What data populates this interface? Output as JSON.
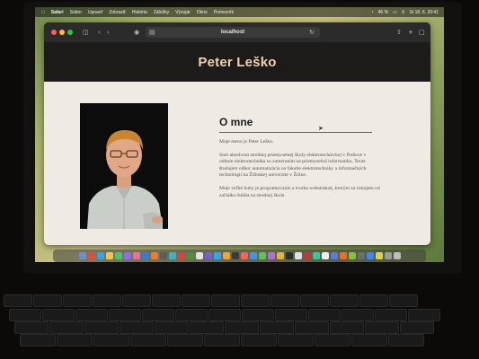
{
  "menubar": {
    "items": [
      "Safari",
      "Súbor",
      "Upraviť",
      "Zobraziť",
      "História",
      "Záložky",
      "Vývojár",
      "Okno",
      "Pomocník"
    ],
    "status": [
      "46 %",
      "St 18. 6.  20:41"
    ]
  },
  "browser": {
    "url": "localhost"
  },
  "site": {
    "title": "Peter Leško"
  },
  "about": {
    "heading": "O mne",
    "paragraphs": [
      "Moje meno je Peter Leško.",
      "Som absolvent strednej priemyselnej školy elektrotechnickej v Prešove v odbore elektrotechnika so zameraním na priemyselnú informatiku. Teraz študujem odbor automatizácia na fakulte elektrotechniky a informačných technológií na Žilinskej univerzite v Žiline.",
      "Moje veľké hoby je programovanie a tvorba webstránok, ktorým sa venujem od začiatku štúdia na strednej škole."
    ]
  },
  "dock": {
    "icon_colors": [
      "#6a8fd0",
      "#e44c3a",
      "#3aa0e8",
      "#f2c14e",
      "#4cc36b",
      "#8c6cf0",
      "#e86fa0",
      "#2f7fd8",
      "#f07b2b",
      "#5c5c5c",
      "#35b5c8",
      "#d94040",
      "#4d8f3f",
      "#e2e2e2",
      "#7b5cd6",
      "#2ea6ff",
      "#f4a13a",
      "#3b3b3b",
      "#ff5e5e",
      "#4a90e2",
      "#58c45a",
      "#b06fd8",
      "#e8b33a",
      "#2d2d2d",
      "#d6e4f0",
      "#c03a3a",
      "#3ac7a0",
      "#f0f0f0",
      "#5a7bd8",
      "#ee6b2b",
      "#87c13a",
      "#6d6d6d",
      "#3f86f5",
      "#e0d050",
      "#9a9a9a",
      "#bcbcbc"
    ]
  }
}
